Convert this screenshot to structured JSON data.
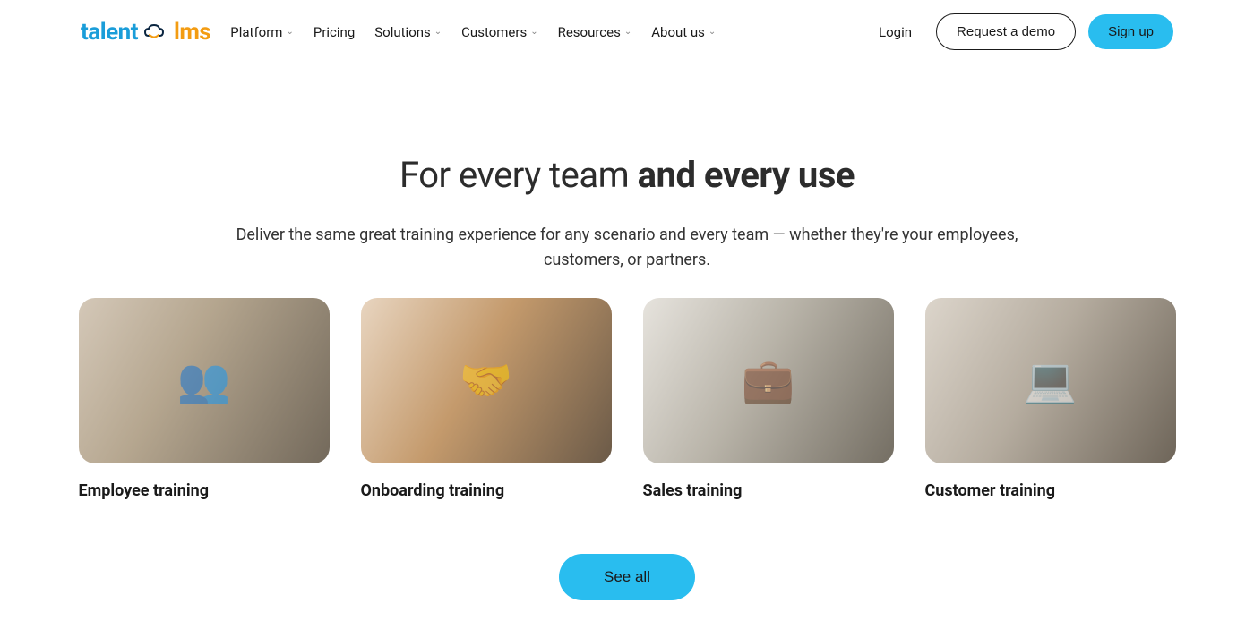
{
  "logo": {
    "part1": "talent",
    "part2": "lms"
  },
  "nav": {
    "items": [
      {
        "label": "Platform",
        "hasDropdown": true
      },
      {
        "label": "Pricing",
        "hasDropdown": false
      },
      {
        "label": "Solutions",
        "hasDropdown": true
      },
      {
        "label": "Customers",
        "hasDropdown": true
      },
      {
        "label": "Resources",
        "hasDropdown": true
      },
      {
        "label": "About us",
        "hasDropdown": true
      }
    ]
  },
  "header_right": {
    "login": "Login",
    "request_demo": "Request a demo",
    "sign_up": "Sign up"
  },
  "hero": {
    "title_light": "For every team ",
    "title_bold": "and every use",
    "subtitle": "Deliver the same great training experience for any scenario and every team — whether they're your employees, customers, or partners."
  },
  "cards": [
    {
      "title": "Employee training"
    },
    {
      "title": "Onboarding training"
    },
    {
      "title": "Sales training"
    },
    {
      "title": "Customer training"
    }
  ],
  "cta": {
    "see_all": "See all"
  },
  "colors": {
    "primary": "#29bdef",
    "logo_blue": "#1a9dd9",
    "logo_orange": "#f39c12"
  }
}
